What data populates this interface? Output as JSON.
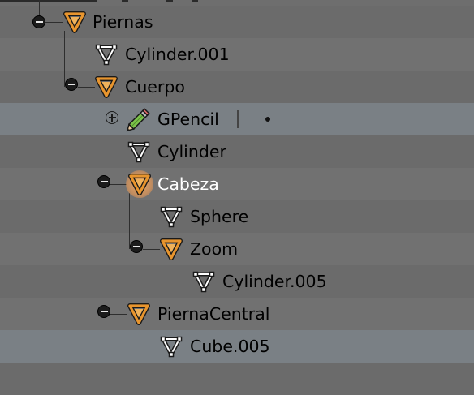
{
  "colors": {
    "object_icon": "#e8952e",
    "mesh_icon": "#ffffff",
    "row_light": "#717171",
    "row_dark": "#6b6b6b",
    "row_highlight": "#7a8085",
    "active_label": "#ffffff"
  },
  "tree": [
    {
      "label": "Piernas",
      "icon": "object-icon",
      "expander": "collapse"
    },
    {
      "label": "Cylinder.001",
      "icon": "mesh-icon"
    },
    {
      "label": "Cuerpo",
      "icon": "object-icon",
      "expander": "collapse"
    },
    {
      "label": "GPencil",
      "icon": "pencil-icon",
      "expander": "expand"
    },
    {
      "label": "Cylinder",
      "icon": "mesh-icon"
    },
    {
      "label": "Cabeza",
      "icon": "object-icon",
      "expander": "collapse",
      "active": true
    },
    {
      "label": "Sphere",
      "icon": "mesh-icon"
    },
    {
      "label": "Zoom",
      "icon": "object-icon",
      "expander": "collapse"
    },
    {
      "label": "Cylinder.005",
      "icon": "mesh-icon"
    },
    {
      "label": "PiernaCentral",
      "icon": "object-icon",
      "expander": "collapse"
    },
    {
      "label": "Cube.005",
      "icon": "mesh-icon"
    }
  ]
}
